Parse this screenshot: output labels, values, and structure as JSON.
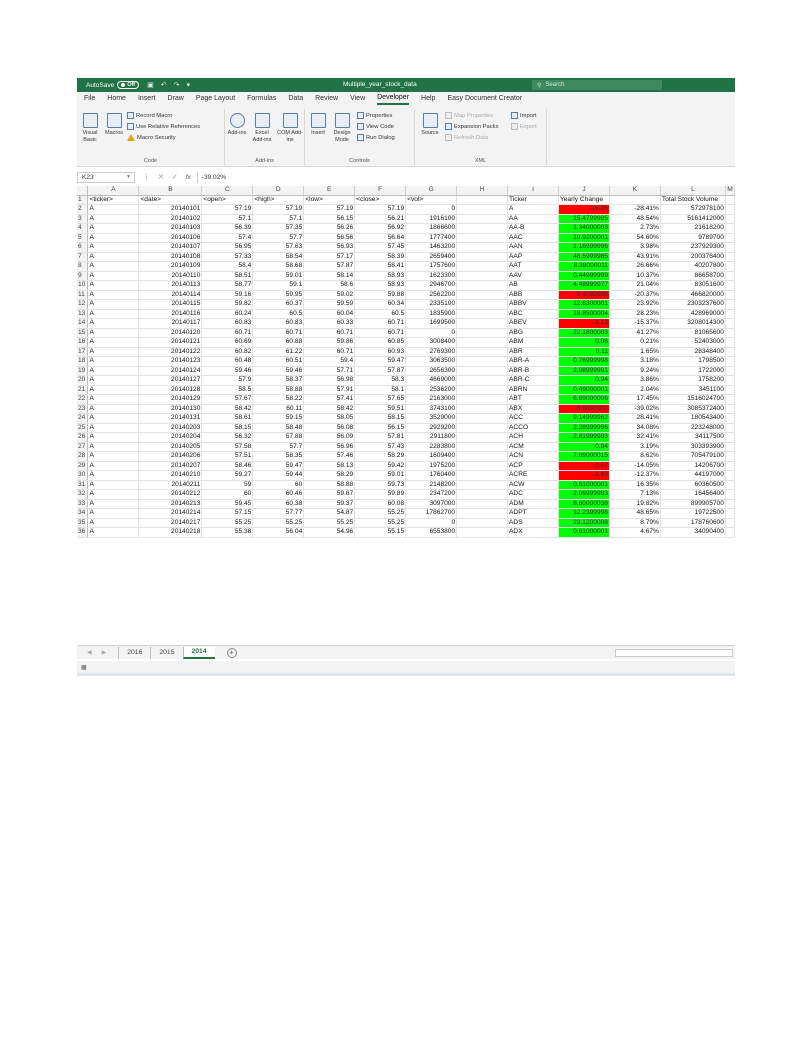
{
  "titlebar": {
    "autosave_label": "AutoSave",
    "autosave_state": "Off",
    "filename": "Multiple_year_stock_data",
    "search_placeholder": "Search"
  },
  "menu": [
    "File",
    "Home",
    "Insert",
    "Draw",
    "Page Layout",
    "Formulas",
    "Data",
    "Review",
    "View",
    "Developer",
    "Help",
    "Easy Document Creator"
  ],
  "active_menu_index": 9,
  "ribbon": {
    "code": {
      "label": "Code",
      "visual_basic": "Visual Basic",
      "macros": "Macros",
      "record_macro": "Record Macro",
      "use_relative": "Use Relative References",
      "macro_security": "Macro Security"
    },
    "addins": {
      "label": "Add-ins",
      "addins": "Add-ins",
      "excel_addins": "Excel Add-ins",
      "com_addins": "COM Add-ins"
    },
    "controls": {
      "label": "Controls",
      "insert": "Insert",
      "design_mode": "Design Mode",
      "properties": "Properties",
      "view_code": "View Code",
      "run_dialog": "Run Dialog"
    },
    "xml": {
      "label": "XML",
      "source": "Source",
      "map_properties": "Map Properties",
      "expansion_packs": "Expansion Packs",
      "refresh_data": "Refresh Data",
      "import": "Import",
      "export": "Export"
    }
  },
  "formula_bar": {
    "cell_ref": "K23",
    "fx": "fx",
    "value": "-39.02%"
  },
  "columns": [
    "A",
    "B",
    "C",
    "D",
    "E",
    "F",
    "G",
    "H",
    "I",
    "J",
    "K",
    "L",
    "M"
  ],
  "header_row": [
    "<ticker>",
    "<date>",
    "<open>",
    "<high>",
    "<low>",
    "<close>",
    "<vol>",
    "",
    "Ticker",
    "Yearly Change",
    "",
    "Total Stock Volume",
    ""
  ],
  "rows": [
    [
      "A",
      "20140101",
      "57.19",
      "57.19",
      "57.19",
      "57.19",
      "0",
      "",
      "A",
      "-16.26",
      "-28.41%",
      "572978100"
    ],
    [
      "A",
      "20140102",
      "57.1",
      "57.1",
      "56.15",
      "56.21",
      "1916100",
      "",
      "AA",
      "15.4799995",
      "48.54%",
      "5161412000"
    ],
    [
      "A",
      "20140103",
      "56.39",
      "57.35",
      "56.26",
      "56.92",
      "1866600",
      "",
      "AA-B",
      "1.34000003",
      "2.73%",
      "21618200"
    ],
    [
      "A",
      "20140106",
      "57.4",
      "57.7",
      "56.56",
      "56.64",
      "1777400",
      "",
      "AAC",
      "10.9200001",
      "54.60%",
      "9789700"
    ],
    [
      "A",
      "20140107",
      "56.95",
      "57.63",
      "56.93",
      "57.45",
      "1463200",
      "",
      "AAN",
      "1.16999996",
      "3.98%",
      "237929300"
    ],
    [
      "A",
      "20140108",
      "57.33",
      "58.54",
      "57.17",
      "58.39",
      "2659400",
      "",
      "AAP",
      "48.5999985",
      "43.91%",
      "200376400"
    ],
    [
      "A",
      "20140109",
      "58.4",
      "58.68",
      "57.87",
      "58.41",
      "1757600",
      "",
      "AAT",
      "8.38000011",
      "26.66%",
      "40207800"
    ],
    [
      "A",
      "20140110",
      "58.51",
      "59.01",
      "58.14",
      "58.93",
      "1623300",
      "",
      "AAV",
      "0.44999999",
      "10.37%",
      "86658700"
    ],
    [
      "A",
      "20140113",
      "58.77",
      "59.1",
      "58.6",
      "58.93",
      "2946700",
      "",
      "AB",
      "4.48999977",
      "21.04%",
      "83051600"
    ],
    [
      "A",
      "20140114",
      "59.16",
      "59.95",
      "59.02",
      "59.88",
      "2562200",
      "",
      "ABB",
      "-5.4099998",
      "-20.37%",
      "466820000"
    ],
    [
      "A",
      "20140115",
      "59.82",
      "60.37",
      "59.59",
      "60.34",
      "2335100",
      "",
      "ABBV",
      "12.6300001",
      "23.92%",
      "2303237600"
    ],
    [
      "A",
      "20140116",
      "60.24",
      "60.5",
      "60.04",
      "60.5",
      "1835900",
      "",
      "ABC",
      "19.8500004",
      "28.23%",
      "428969000"
    ],
    [
      "A",
      "20140117",
      "60.83",
      "60.83",
      "60.33",
      "60.71",
      "1699500",
      "",
      "ABEV",
      "-1.13",
      "-15.37%",
      "3208014300"
    ],
    [
      "A",
      "20140120",
      "60.71",
      "60.71",
      "60.71",
      "60.71",
      "0",
      "",
      "ABG",
      "22.1800003",
      "41.27%",
      "81065600"
    ],
    [
      "A",
      "20140121",
      "60.69",
      "60.88",
      "59.86",
      "60.85",
      "3008400",
      "",
      "ABM",
      "0.06",
      "0.21%",
      "52403000"
    ],
    [
      "A",
      "20140122",
      "60.82",
      "61.22",
      "60.71",
      "60.93",
      "2769300",
      "",
      "ABR",
      "0.11",
      "1.65%",
      "28348400"
    ],
    [
      "A",
      "20140123",
      "60.48",
      "60.51",
      "59.4",
      "59.47",
      "3063500",
      "",
      "ABR-A",
      "0.76999998",
      "3.18%",
      "1798500"
    ],
    [
      "A",
      "20140124",
      "59.46",
      "59.46",
      "57.71",
      "57.87",
      "2656300",
      "",
      "ABR-B",
      "2.08999991",
      "9.24%",
      "1722000"
    ],
    [
      "A",
      "20140127",
      "57.9",
      "58.37",
      "56.98",
      "58.3",
      "4669000",
      "",
      "ABR-C",
      "0.94",
      "3.86%",
      "1758200"
    ],
    [
      "A",
      "20140128",
      "58.5",
      "58.88",
      "57.91",
      "58.1",
      "2536200",
      "",
      "ABRN",
      "0.49000001",
      "2.04%",
      "3451100"
    ],
    [
      "A",
      "20140129",
      "57.67",
      "58.22",
      "57.41",
      "57.65",
      "2163000",
      "",
      "ABT",
      "6.69000006",
      "17.45%",
      "1516024700"
    ],
    [
      "A",
      "20140130",
      "58.42",
      "60.11",
      "58.42",
      "59.51",
      "3743100",
      "",
      "ABX",
      "-5.8800001",
      "-39.02%",
      "3085372400"
    ],
    [
      "A",
      "20140131",
      "58.61",
      "59.15",
      "58.05",
      "58.15",
      "3529000",
      "",
      "ACC",
      "9.14999962",
      "28.41%",
      "180543400"
    ],
    [
      "A",
      "20140203",
      "58.15",
      "58.48",
      "56.08",
      "56.15",
      "2929200",
      "",
      "ACCO",
      "2.28999996",
      "34.08%",
      "223248000"
    ],
    [
      "A",
      "20140204",
      "56.32",
      "57.88",
      "56.09",
      "57.81",
      "2911800",
      "",
      "ACH",
      "2.81999993",
      "32.41%",
      "34117500"
    ],
    [
      "A",
      "20140205",
      "57.58",
      "57.7",
      "56.96",
      "57.43",
      "2283800",
      "",
      "ACM",
      "0.94",
      "3.19%",
      "303393900"
    ],
    [
      "A",
      "20140206",
      "57.51",
      "58.35",
      "57.46",
      "58.29",
      "1609400",
      "",
      "ACN",
      "7.09000015",
      "8.62%",
      "705479100"
    ],
    [
      "A",
      "20140207",
      "58.46",
      "59.47",
      "58.13",
      "59.42",
      "1975200",
      "",
      "ACP",
      "-2.47",
      "-14.05%",
      "14206700"
    ],
    [
      "A",
      "20140210",
      "59.27",
      "59.44",
      "58.29",
      "59.01",
      "1760400",
      "",
      "ACRE",
      "-1.62",
      "-12.37%",
      "44197000"
    ],
    [
      "A",
      "20140211",
      "59",
      "60",
      "58.88",
      "59.73",
      "2148200",
      "",
      "ACW",
      "0.61000001",
      "16.35%",
      "60360500"
    ],
    [
      "A",
      "20140212",
      "60",
      "60.46",
      "59.67",
      "59.89",
      "2347200",
      "",
      "ADC",
      "2.06999993",
      "7.13%",
      "16456400"
    ],
    [
      "A",
      "20140213",
      "59.45",
      "60.38",
      "59.37",
      "60.08",
      "3097000",
      "",
      "ADM",
      "8.60000038",
      "19.82%",
      "899905700"
    ],
    [
      "A",
      "20140214",
      "57.15",
      "57.77",
      "54.87",
      "55.25",
      "17862700",
      "",
      "ADPT",
      "12.2399998",
      "48.65%",
      "19722500"
    ],
    [
      "A",
      "20140217",
      "55.25",
      "55.25",
      "55.25",
      "55.25",
      "0",
      "",
      "ADS",
      "23.1200008",
      "8.79%",
      "178760600"
    ],
    [
      "A",
      "20140218",
      "55.38",
      "56.04",
      "54.96",
      "55.15",
      "6553800",
      "",
      "ADX",
      "0.61000001",
      "4.67%",
      "34090400"
    ]
  ],
  "sheets": [
    "2016",
    "2015",
    "2014"
  ],
  "active_sheet_index": 2,
  "colors": {
    "excel_green": "#217346",
    "positive_fill": "#00ff00",
    "negative_fill": "#ff0000"
  }
}
